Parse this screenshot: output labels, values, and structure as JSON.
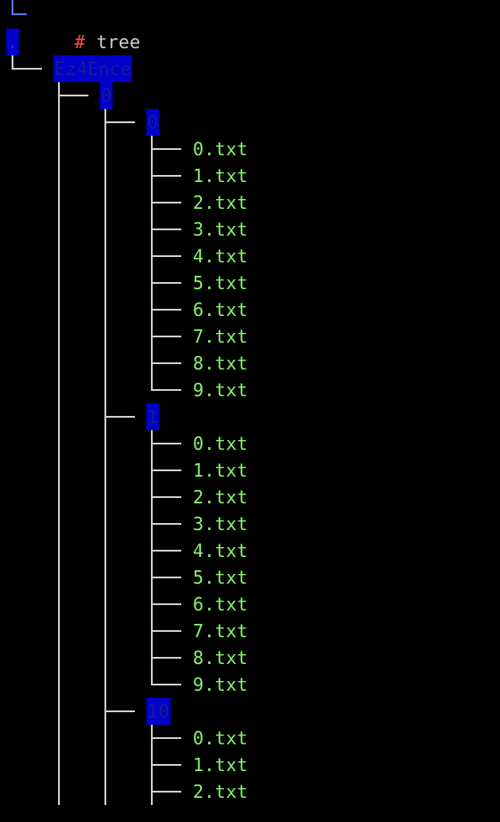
{
  "theme": {
    "background": "#000000",
    "prompt_symbol_color": "#ff4d4d",
    "command_color": "#cfcfcf",
    "file_color": "#86f56b",
    "directory_highlight": "#0000cc",
    "tree_line_color": "#cfcfcf",
    "prompt_line_color": "#5a78ff"
  },
  "prompt": {
    "symbol": "#",
    "command": "tree"
  },
  "tree": {
    "root_label": ".",
    "top_dir": "Ez4Ence",
    "level1_dir": "0",
    "groups": [
      {
        "name": "0",
        "files": [
          "0.txt",
          "1.txt",
          "2.txt",
          "3.txt",
          "4.txt",
          "5.txt",
          "6.txt",
          "7.txt",
          "8.txt",
          "9.txt"
        ]
      },
      {
        "name": "1",
        "files": [
          "0.txt",
          "1.txt",
          "2.txt",
          "3.txt",
          "4.txt",
          "5.txt",
          "6.txt",
          "7.txt",
          "8.txt",
          "9.txt"
        ]
      },
      {
        "name": "10",
        "files": [
          "0.txt",
          "1.txt",
          "2.txt"
        ]
      }
    ]
  }
}
